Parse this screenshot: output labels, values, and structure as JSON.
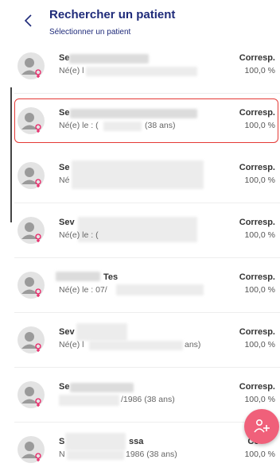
{
  "header": {
    "title": "Rechercher un patient",
    "subtitle": "Sélectionner un patient",
    "back_icon": "chevron-left-icon"
  },
  "colors": {
    "title": "#1f2b7a",
    "selected_border": "#e53935",
    "fab": "#f0607a",
    "female_symbol": "#e91e63"
  },
  "patients": [
    {
      "name": "Se",
      "dob": "Né(e) l",
      "match_label": "Corresp.",
      "match_value": "100,0 %",
      "selected": false
    },
    {
      "name": "Se",
      "dob": "Né(e) le : (",
      "dob_suffix": "(38 ans)",
      "match_label": "Corresp.",
      "match_value": "100,0 %",
      "selected": true
    },
    {
      "name": "Se",
      "dob": "Né",
      "match_label": "Corresp.",
      "match_value": "100,0 %",
      "selected": false
    },
    {
      "name": "Sev",
      "dob": "Né(e) le : (",
      "match_label": "Corresp.",
      "match_value": "100,0 %",
      "selected": false
    },
    {
      "name": "Tes",
      "dob": "Né(e) le : 07/",
      "match_label": "Corresp.",
      "match_value": "100,0 %",
      "selected": false
    },
    {
      "name": "Sev",
      "dob": "Né(e) l",
      "dob_suffix": "ans)",
      "match_label": "Corresp.",
      "match_value": "100,0 %",
      "selected": false
    },
    {
      "name": "Se",
      "dob": "",
      "dob_suffix": "/1986 (38 ans)",
      "match_label": "Corresp.",
      "match_value": "100,0 %",
      "selected": false
    },
    {
      "name": "S",
      "name_suffix": "ssa",
      "dob": "N",
      "dob_suffix": "1986 (38 ans)",
      "match_label": "Co",
      "match_value": "100,0 %",
      "selected": false
    }
  ],
  "fab": {
    "icon": "add-person-icon"
  }
}
